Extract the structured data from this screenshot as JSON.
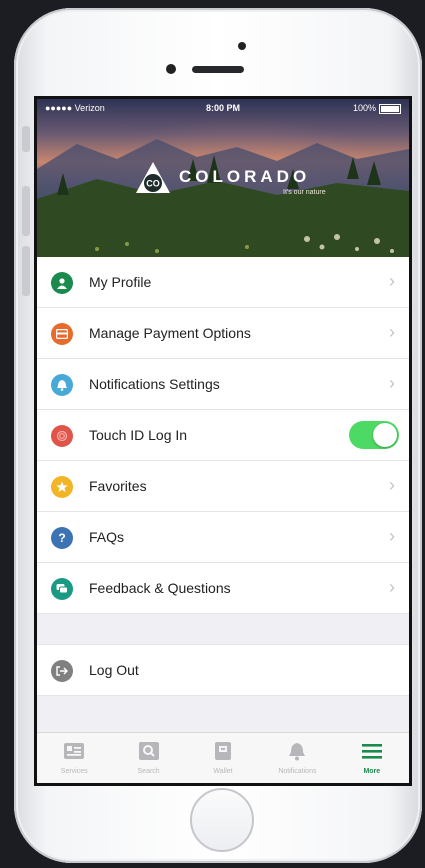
{
  "status": {
    "carrier": "●●●●● Verizon",
    "time": "8:00 PM",
    "battery": "100%"
  },
  "brand": {
    "name": "COLORADO",
    "monogram": "CO",
    "tagline": "It's our nature"
  },
  "menu": [
    {
      "label": "My Profile",
      "icon": "person-icon",
      "color": "#1b8a4d",
      "control": "chevron"
    },
    {
      "label": "Manage Payment Options",
      "icon": "card-icon",
      "color": "#e76b2c",
      "control": "chevron"
    },
    {
      "label": "Notifications Settings",
      "icon": "bell-icon",
      "color": "#46a9d8",
      "control": "chevron"
    },
    {
      "label": "Touch ID Log In",
      "icon": "fingerprint-icon",
      "color": "#e0554a",
      "control": "toggle",
      "toggle_on": true
    },
    {
      "label": "Favorites",
      "icon": "star-icon",
      "color": "#f2b526",
      "control": "chevron"
    },
    {
      "label": "FAQs",
      "icon": "question-icon",
      "color": "#3c73b3",
      "glyph": "?",
      "control": "chevron"
    },
    {
      "label": "Feedback & Questions",
      "icon": "chat-icon",
      "color": "#1a9a82",
      "control": "chevron"
    }
  ],
  "logout": {
    "label": "Log Out",
    "icon": "logout-icon",
    "color": "#808080"
  },
  "tabs": [
    {
      "label": "Services",
      "icon": "services-icon",
      "active": false
    },
    {
      "label": "Search",
      "icon": "search-icon",
      "active": false
    },
    {
      "label": "Wallet",
      "icon": "wallet-icon",
      "active": false
    },
    {
      "label": "Notifications",
      "icon": "bell-icon",
      "active": false
    },
    {
      "label": "More",
      "icon": "menu-icon",
      "active": true
    }
  ],
  "colors": {
    "accent": "#1b8a4d",
    "toggle_on": "#4cd964",
    "background": "#efeff4"
  }
}
